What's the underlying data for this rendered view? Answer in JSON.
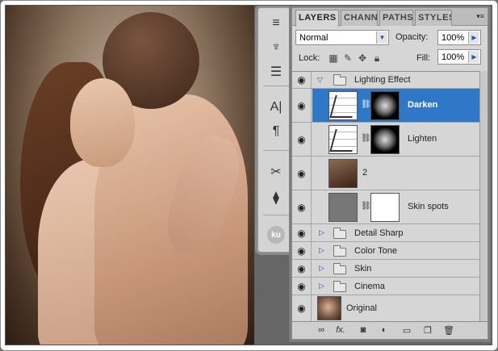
{
  "panel": {
    "tabs": [
      {
        "label": "LAYERS",
        "active": true
      },
      {
        "label": "CHANN",
        "active": false
      },
      {
        "label": "PATHS",
        "active": false
      },
      {
        "label": "STYLES",
        "active": false
      }
    ],
    "blend_mode": "Normal",
    "opacity_label": "Opacity:",
    "opacity_value": "100%",
    "lock_label": "Lock:",
    "fill_label": "Fill:",
    "fill_value": "100%"
  },
  "toolstrip": {
    "badge": "ku"
  },
  "layers": [
    {
      "name": "Lighting Effect",
      "type": "group",
      "expanded": true
    },
    {
      "name": "Darken",
      "type": "adjustment",
      "selected": true
    },
    {
      "name": "Lighten",
      "type": "adjustment"
    },
    {
      "name": "2",
      "type": "image"
    },
    {
      "name": "Skin spots",
      "type": "masked"
    },
    {
      "name": "Detail Sharp",
      "type": "group"
    },
    {
      "name": "Color Tone",
      "type": "group"
    },
    {
      "name": "Skin",
      "type": "group"
    },
    {
      "name": "Cinema",
      "type": "group"
    },
    {
      "name": "Original",
      "type": "image"
    }
  ],
  "icons": {
    "eye": "eye-icon",
    "folder": "folder-icon",
    "link": "link-icon",
    "fx": "fx-icon"
  },
  "colors": {
    "selected": "#2f78c8",
    "panel": "#d6d6d6"
  }
}
